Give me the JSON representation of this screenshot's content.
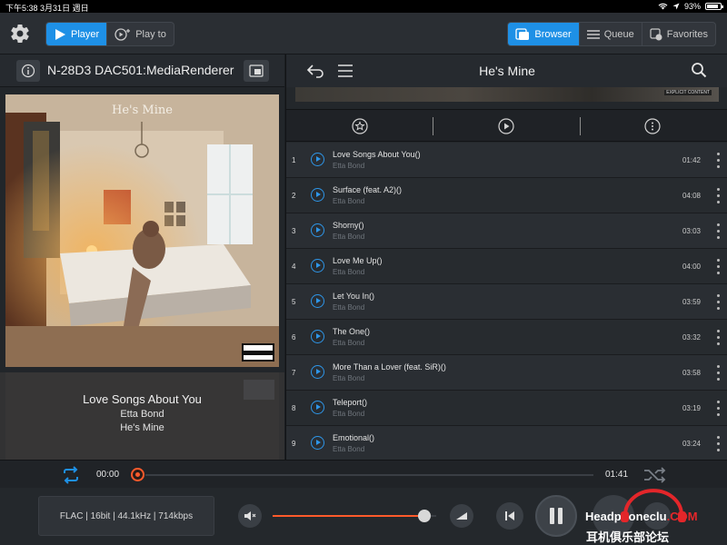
{
  "status_bar": {
    "time": "下午5:38",
    "date": "3月31日 週日",
    "battery": "93%"
  },
  "toolbar": {
    "player_label": "Player",
    "playto_label": "Play to",
    "browser_label": "Browser",
    "queue_label": "Queue",
    "favorites_label": "Favorites"
  },
  "renderer": {
    "name": "N-28D3 DAC501:MediaRenderer"
  },
  "cover": {
    "title": "He's Mine",
    "badge": "PARENTAL ADVISORY"
  },
  "now_playing": {
    "title": "Love Songs About You",
    "artist": "Etta Bond",
    "album": "He's Mine"
  },
  "browser": {
    "title": "He's Mine",
    "strip_tag": "EXPLICIT CONTENT"
  },
  "tracks": [
    {
      "num": "1",
      "title": "Love Songs About You()",
      "artist": "Etta Bond",
      "duration": "01:42"
    },
    {
      "num": "2",
      "title": "Surface (feat. A2)()",
      "artist": "Etta Bond",
      "duration": "04:08"
    },
    {
      "num": "3",
      "title": "Shorny()",
      "artist": "Etta Bond",
      "duration": "03:03"
    },
    {
      "num": "4",
      "title": "Love Me Up()",
      "artist": "Etta Bond",
      "duration": "04:00"
    },
    {
      "num": "5",
      "title": "Let You In()",
      "artist": "Etta Bond",
      "duration": "03:59"
    },
    {
      "num": "6",
      "title": "The One()",
      "artist": "Etta Bond",
      "duration": "03:32"
    },
    {
      "num": "7",
      "title": "More Than a Lover (feat. SiR)()",
      "artist": "Etta Bond",
      "duration": "03:58"
    },
    {
      "num": "8",
      "title": "Teleport()",
      "artist": "Etta Bond",
      "duration": "03:19"
    },
    {
      "num": "9",
      "title": "Emotional()",
      "artist": "Etta Bond",
      "duration": "03:24"
    }
  ],
  "playback": {
    "elapsed": "00:00",
    "total": "01:41",
    "progress_fraction": 0.0,
    "volume_fraction": 0.93,
    "format": "FLAC | 16bit | 44.1kHz | 714kbps"
  },
  "watermark": {
    "line1_pre": "Head",
    "line1_mid": "phone",
    "line1_post": "clu",
    "line1_end": ".COM",
    "line2": "耳机俱乐部论坛"
  },
  "colors": {
    "accent_blue": "#1e90e6",
    "accent_orange": "#ff5a2b",
    "background": "#1b1e22"
  }
}
